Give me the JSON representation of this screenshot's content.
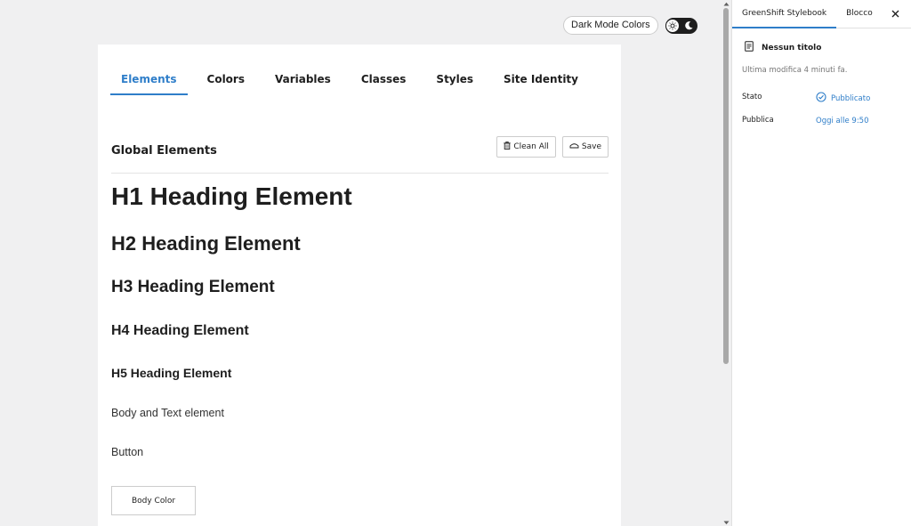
{
  "header": {
    "dark_mode_label": "Dark Mode Colors"
  },
  "stylebook": {
    "tabs": [
      {
        "label": "Elements",
        "active": true
      },
      {
        "label": "Colors",
        "active": false
      },
      {
        "label": "Variables",
        "active": false
      },
      {
        "label": "Classes",
        "active": false
      },
      {
        "label": "Styles",
        "active": false
      },
      {
        "label": "Site Identity",
        "active": false
      }
    ],
    "section_title": "Global Elements",
    "clean_all_label": "Clean All",
    "save_label": "Save",
    "elements": {
      "h1": "H1 Heading Element",
      "h2": "H2 Heading Element",
      "h3": "H3 Heading Element",
      "h4": "H4 Heading Element",
      "h5": "H5 Heading Element",
      "body": "Body and Text element",
      "button": "Button",
      "body_color_button": "Body Color"
    }
  },
  "sidebar": {
    "tabs": [
      {
        "label": "GreenShift Stylebook",
        "active": true
      },
      {
        "label": "Blocco",
        "active": false
      }
    ],
    "doc_title": "Nessun titolo",
    "last_modified": "Ultima modifica 4 minuti fa.",
    "status_label": "Stato",
    "status_value": "Pubblicato",
    "publish_label": "Pubblica",
    "publish_value": "Oggi alle 9:50"
  },
  "colors": {
    "accent": "#2f7ec9",
    "text": "#1e1e1e",
    "canvas_bg": "#f0f0f1"
  },
  "icons": [
    "sun-icon",
    "moon-icon",
    "trash-icon",
    "save-icon",
    "close-icon",
    "document-icon",
    "check-circle-icon"
  ]
}
